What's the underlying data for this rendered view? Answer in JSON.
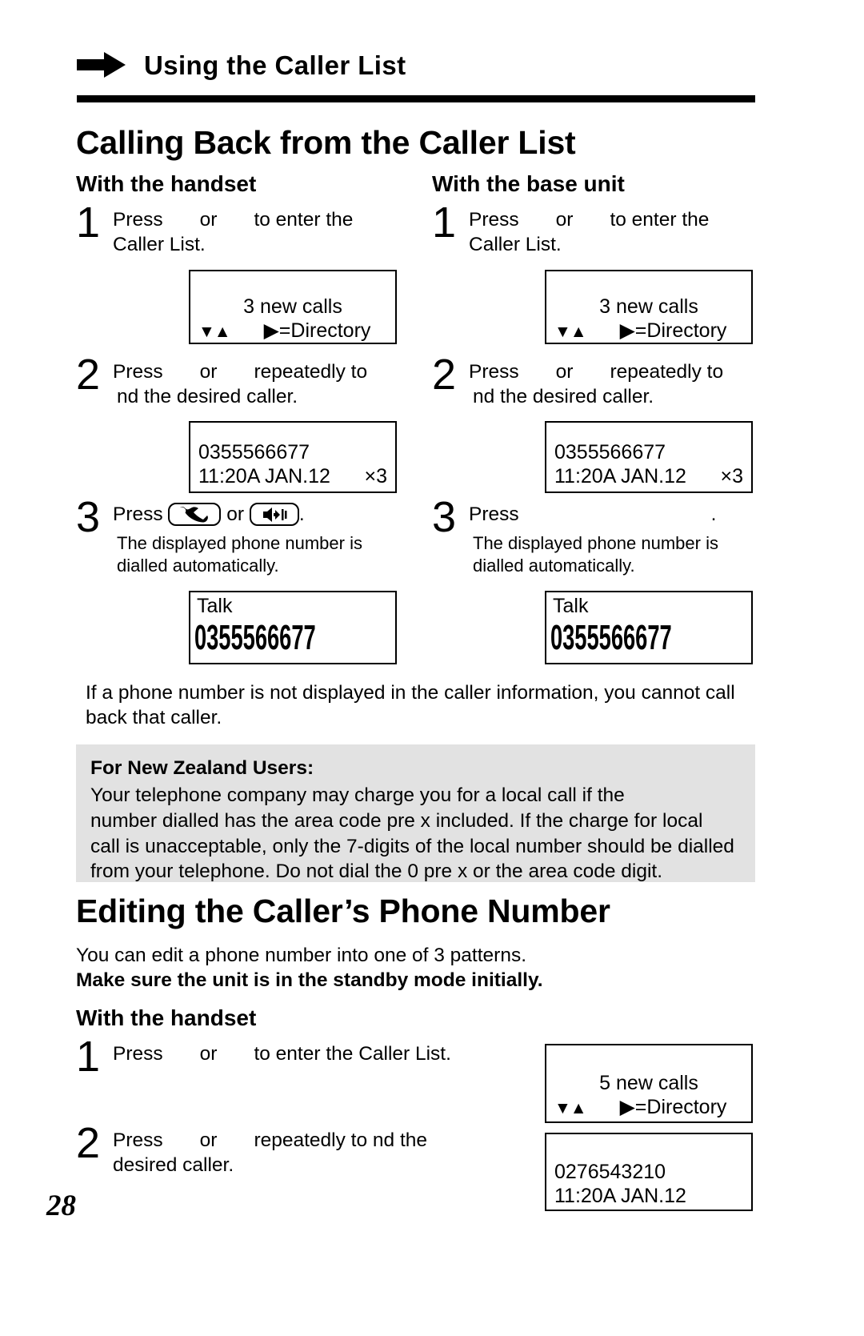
{
  "running_head": {
    "icon": "right-arrow-icon",
    "title": "Using the Caller List"
  },
  "sections": [
    {
      "heading": "Calling Back from the Caller List",
      "columns": [
        {
          "subheading": "With the handset",
          "steps": [
            {
              "number": "1",
              "text_before": "Press",
              "text_mid": "or",
              "text_after": "to enter the",
              "text_line2": "Caller List."
            },
            {
              "number": "2",
              "text_before": "Press",
              "text_mid": "or",
              "text_after": "repeatedly to",
              "text_line2": "nd the desired caller."
            },
            {
              "number": "3",
              "text_before": "Press",
              "text_mid": "or",
              "text_after": ".",
              "note_line1": "The displayed phone number is",
              "note_line2": "dialled automatically."
            }
          ],
          "displays": [
            {
              "line1": "3 new calls",
              "left_arrows": "▼▲",
              "right_text": "▶=Directory"
            },
            {
              "line1": "0355566677",
              "line2_left": "11:20A JAN.12",
              "line2_right": "×3"
            },
            {
              "line1": "Talk",
              "bignum": "0355566677"
            }
          ]
        },
        {
          "subheading": "With the base unit",
          "steps": [
            {
              "number": "1",
              "text_before": "Press",
              "text_mid": "or",
              "text_after": "to enter the",
              "text_line2": "Caller List."
            },
            {
              "number": "2",
              "text_before": "Press",
              "text_mid": "or",
              "text_after": "repeatedly to",
              "text_line2": "nd the desired caller."
            },
            {
              "number": "3",
              "text_before": "Press",
              "text_after": ".",
              "note_line1": "The displayed phone number is",
              "note_line2": "dialled automatically."
            }
          ],
          "displays": [
            {
              "line1": "3 new calls",
              "left_arrows": "▼▲",
              "right_text": "▶=Directory"
            },
            {
              "line1": "0355566677",
              "line2_left": "11:20A JAN.12",
              "line2_right": "×3"
            },
            {
              "line1": "Talk",
              "bignum": "0355566677"
            }
          ]
        }
      ],
      "footnote": "If a phone number is not displayed in the caller information, you cannot call back that caller.",
      "notebox": {
        "title": "For New Zealand Users:",
        "lines": [
          "Your telephone company may charge you for a local call if the",
          "number dialled has the area code pre  x included. If the charge for local",
          "call is unacceptable, only the 7-digits of the local number should be dialled",
          "from your telephone. Do not dial the  0  pre  x or the area code digit."
        ]
      }
    },
    {
      "heading": "Editing the Caller’s Phone Number",
      "intro_line1": "You can edit a phone number into one of 3 patterns.",
      "intro_line2_bold": "Make sure the unit is in the standby mode initially.",
      "subheading": "With the handset",
      "steps": [
        {
          "number": "1",
          "text_before": "Press",
          "text_mid": "or",
          "text_after": "to enter the Caller List."
        },
        {
          "number": "2",
          "text_before": "Press",
          "text_mid": "or",
          "text_after": "repeatedly to  nd the",
          "text_line2": "desired caller."
        }
      ],
      "displays": [
        {
          "line1": "5 new calls",
          "left_arrows": "▼▲",
          "right_text": "▶=Directory"
        },
        {
          "line1": "0276543210",
          "line2_left": "11:20A JAN.12"
        }
      ]
    }
  ],
  "page_number": "28",
  "colors": {
    "note_background": "#e2e2e2",
    "text": "#000000",
    "page_background": "#ffffff"
  }
}
